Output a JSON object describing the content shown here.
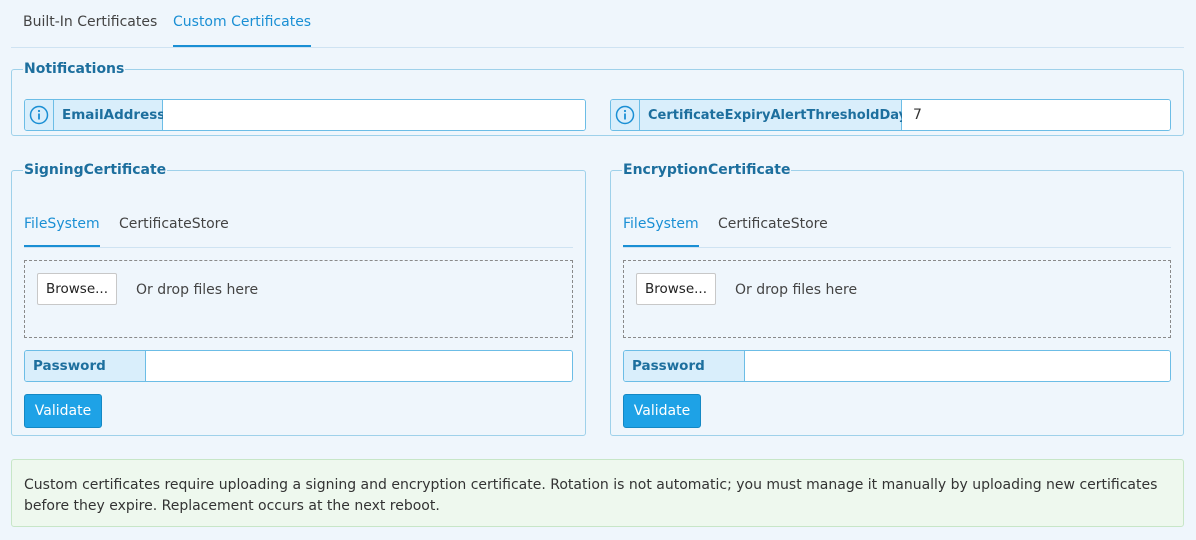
{
  "tabs": [
    {
      "label": "Built-In Certificates",
      "active": false
    },
    {
      "label": "Custom Certificates",
      "active": true
    }
  ],
  "notifications": {
    "legend": "Notifications",
    "email": {
      "label": "EmailAddress",
      "value": ""
    },
    "threshold": {
      "label": "CertificateExpiryAlertThresholdDays",
      "value": "7"
    }
  },
  "signing": {
    "legend": "SigningCertificate",
    "tabs": [
      {
        "label": "FileSystem",
        "active": true
      },
      {
        "label": "CertificateStore",
        "active": false
      }
    ],
    "browse_label": "Browse...",
    "drop_text": "Or drop files here",
    "password_label": "Password",
    "password_value": "",
    "validate_label": "Validate"
  },
  "encryption": {
    "legend": "EncryptionCertificate",
    "tabs": [
      {
        "label": "FileSystem",
        "active": true
      },
      {
        "label": "CertificateStore",
        "active": false
      }
    ],
    "browse_label": "Browse...",
    "drop_text": "Or drop files here",
    "password_label": "Password",
    "password_value": "",
    "validate_label": "Validate"
  },
  "note": "Custom certificates require uploading a signing and encryption certificate. Rotation is not automatic; you must manage it manually by uploading new certificates before they expire. Replacement occurs at the next reboot.",
  "colors": {
    "accent": "#1a8fd4",
    "button": "#1ea2e6",
    "border": "#9fd1ea",
    "note_bg": "#eef8ee"
  }
}
